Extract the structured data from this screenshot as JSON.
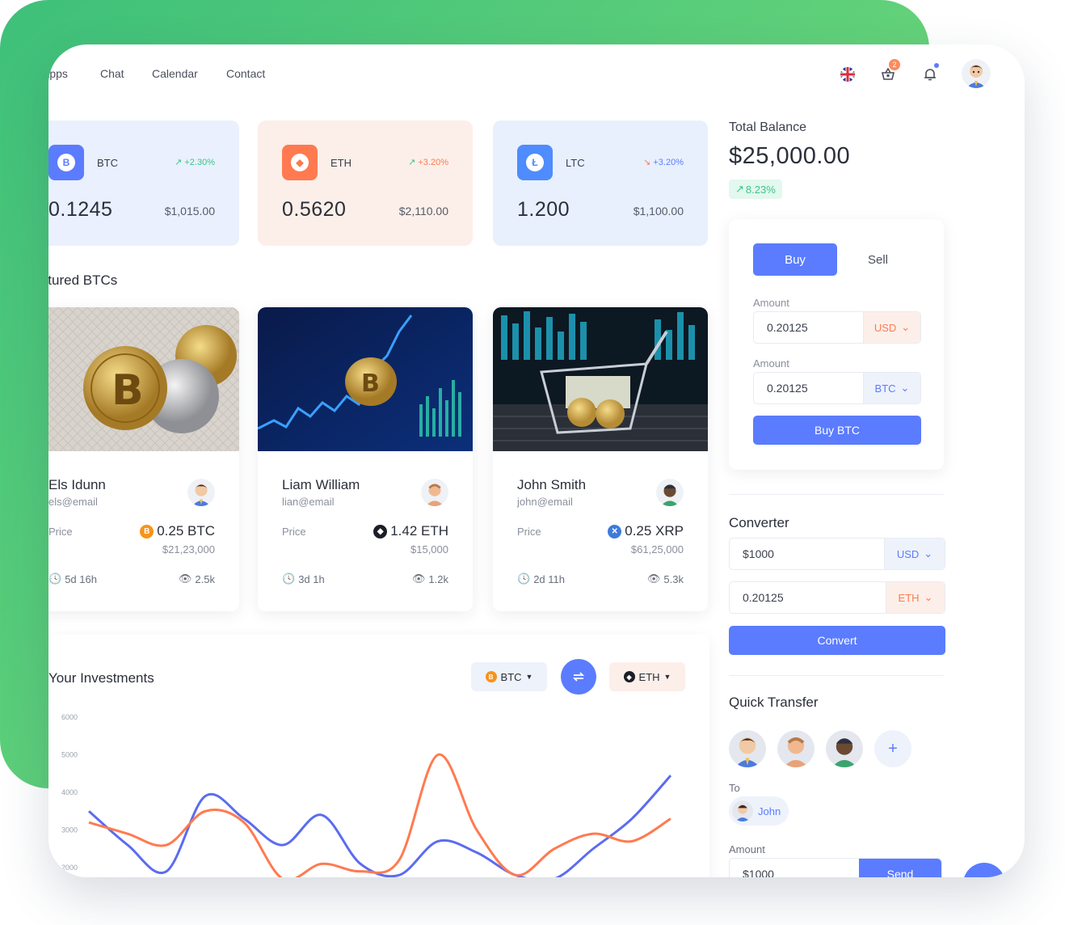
{
  "nav": {
    "apps": "Apps",
    "chat": "Chat",
    "calendar": "Calendar",
    "contact": "Contact"
  },
  "header": {
    "cart_count": "2"
  },
  "coins": [
    {
      "symbol": "BTC",
      "change": "+2.30%",
      "trend": "up",
      "amount": "0.1245",
      "usd": "$1,015.00"
    },
    {
      "symbol": "ETH",
      "change": "+3.20%",
      "trend": "up",
      "amount": "0.5620",
      "usd": "$2,110.00"
    },
    {
      "symbol": "LTC",
      "change": "+3.20%",
      "trend": "down",
      "amount": "1.200",
      "usd": "$1,100.00"
    }
  ],
  "featured": {
    "title": "Featured BTCs",
    "cards": [
      {
        "name": "Els Idunn",
        "email": "els@email",
        "price_label": "Price",
        "price": "0.25 BTC",
        "price_usd": "$21,23,000",
        "time": "5d 16h",
        "views": "2.5k"
      },
      {
        "name": "Liam William",
        "email": "lian@email",
        "price_label": "Price",
        "price": "1.42 ETH",
        "price_usd": "$15,000",
        "time": "3d 1h",
        "views": "1.2k"
      },
      {
        "name": "John Smith",
        "email": "john@email",
        "price_label": "Price",
        "price": "0.25 XRP",
        "price_usd": "$61,25,000",
        "time": "2d 11h",
        "views": "5.3k"
      }
    ]
  },
  "investments": {
    "title": "Your Investments",
    "from_coin": "BTC",
    "to_coin": "ETH"
  },
  "chart_data": {
    "type": "line",
    "title": "Your Investments",
    "yticks": [
      "6000",
      "5000",
      "4000",
      "3000",
      "2000"
    ],
    "ylim": [
      2000,
      6000
    ],
    "x": [
      0,
      1,
      2,
      3,
      4,
      5,
      6,
      7,
      8,
      9,
      10,
      11,
      12,
      13,
      14,
      15
    ],
    "series": [
      {
        "color": "#5b6cf0",
        "values": [
          3500,
          2600,
          1900,
          3900,
          3300,
          2600,
          3400,
          2100,
          1800,
          2700,
          2400,
          1800,
          1700,
          2500,
          3300,
          4450
        ]
      },
      {
        "color": "#ff7a50",
        "values": [
          3200,
          2900,
          2600,
          3500,
          3200,
          1700,
          2100,
          1900,
          2200,
          5000,
          3000,
          1800,
          2500,
          2900,
          2700,
          3300
        ]
      }
    ]
  },
  "balance": {
    "label": "Total Balance",
    "value": "$25,000.00",
    "change": "8.23%"
  },
  "trade": {
    "buy_tab": "Buy",
    "sell_tab": "Sell",
    "amount_label_1": "Amount",
    "amount_value_1": "0.20125",
    "currency_1": "USD",
    "amount_label_2": "Amount",
    "amount_value_2": "0.20125",
    "currency_2": "BTC",
    "submit": "Buy BTC"
  },
  "converter": {
    "title": "Converter",
    "value_1": "$1000",
    "currency_1": "USD",
    "value_2": "0.20125",
    "currency_2": "ETH",
    "submit": "Convert"
  },
  "transfer": {
    "title": "Quick Transfer",
    "to_label": "To",
    "recipient": "John",
    "amount_label": "Amount",
    "amount_value": "$1000",
    "send": "Send"
  },
  "colors": {
    "accent": "#5b7cff",
    "btc_card": "#eaf0fd",
    "eth_card": "#fcefe9",
    "ltc_card": "#e8f0fd",
    "green": "#3dc48a",
    "orange": "#ff7a50"
  }
}
